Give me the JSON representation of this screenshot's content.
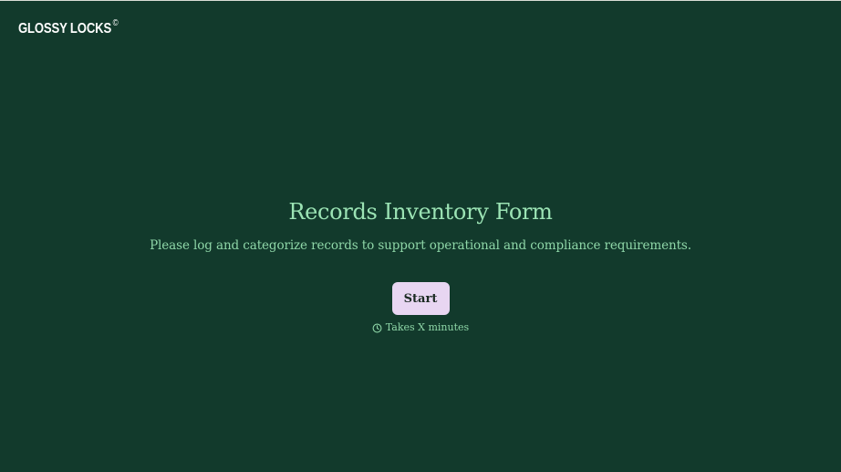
{
  "brand": {
    "name": "GLOSSY LOCKS",
    "mark": "©"
  },
  "form": {
    "title": "Records Inventory Form",
    "description": "Please log and categorize records to support operational and compliance requirements.",
    "start_label": "Start",
    "duration_text": "Takes X minutes",
    "duration_icon": "clock-icon"
  },
  "colors": {
    "background": "#123a2c",
    "accent_text": "#9be3b4",
    "button_bg": "#e8d6f2"
  }
}
